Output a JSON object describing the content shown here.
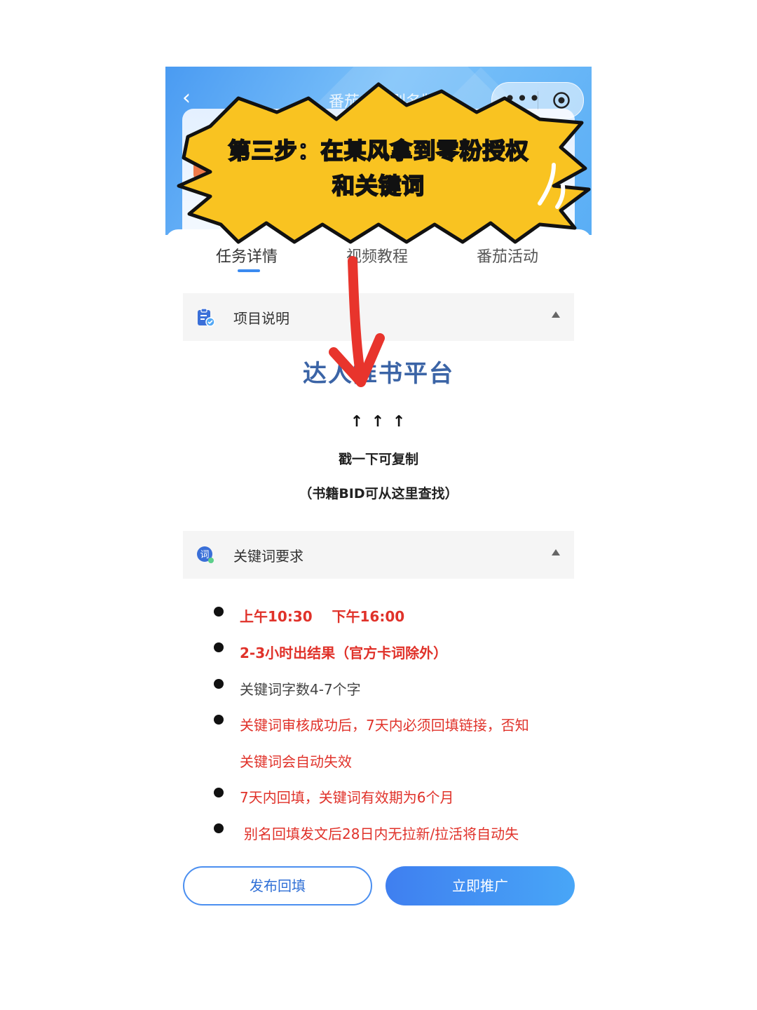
{
  "nav": {
    "title": "番茄小说别名版",
    "more_glyph": "•••"
  },
  "overlay": {
    "line1": "第三步：在某风拿到零粉授权",
    "line2": "和关键词",
    "burst_color": "#f9c321",
    "arrow_color": "#e8342c"
  },
  "tabs": [
    {
      "label": "任务详情",
      "active": true
    },
    {
      "label": "视频教程",
      "active": false
    },
    {
      "label": "番茄活动",
      "active": false
    }
  ],
  "project": {
    "section_label": "项目说明",
    "platform_title": "达人推书平台",
    "arrows": "↑ ↑ ↑",
    "copy_tip": "戳一下可复制",
    "bid_tip": "（书籍BID可从这里查找）"
  },
  "keywords": {
    "section_label": "关键词要求",
    "icon_text": "词",
    "items": [
      {
        "text": "上午10:30    下午16:00",
        "color": "red",
        "bold": true
      },
      {
        "text": "2-3小时出结果（官方卡词除外）",
        "color": "red",
        "bold": true
      },
      {
        "text": "关键词字数4-7个字",
        "color": "gray",
        "bold": false
      },
      {
        "text": "关键词审核成功后，7天内必须回填链接，否知",
        "text2": "关键词会自动失效",
        "color": "red",
        "bold": false
      },
      {
        "text": "7天内回填，关键词有效期为6个月",
        "color": "red",
        "bold": false
      },
      {
        "text": "别名回填发文后28日内无拉新/拉活将自动失",
        "color": "red",
        "bold": false
      }
    ]
  },
  "buttons": {
    "publish": "发布回填",
    "promote": "立即推广"
  },
  "colors": {
    "accent": "#3a8af0",
    "title_blue": "#3b64a6",
    "warning_red": "#e0322a"
  }
}
